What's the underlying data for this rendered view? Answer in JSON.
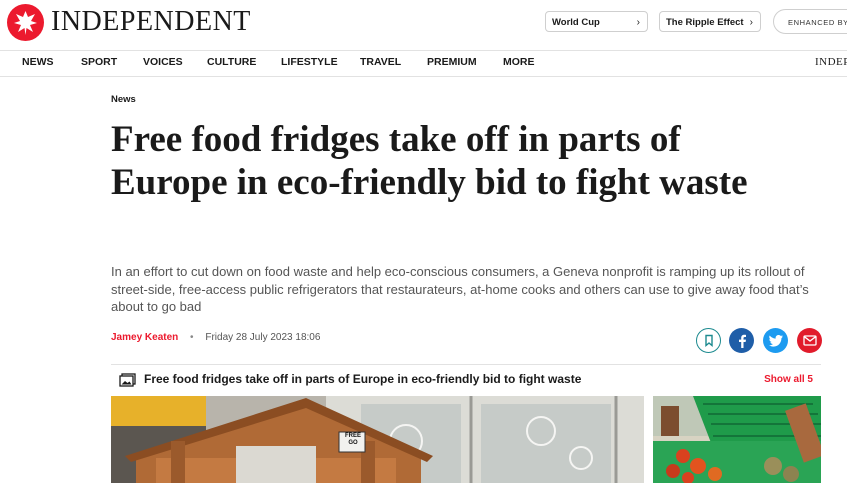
{
  "brand": {
    "wordmark": "INDEPENDENT",
    "nav_wordmark": "INDEP"
  },
  "header": {
    "pills": [
      {
        "label": "World Cup",
        "chevron": "›"
      },
      {
        "label": "The Ripple Effect",
        "chevron": "›"
      }
    ],
    "enhanced_label": "ENHANCED BY"
  },
  "nav": {
    "items": [
      "NEWS",
      "SPORT",
      "VOICES",
      "CULTURE",
      "LIFESTYLE",
      "TRAVEL",
      "PREMIUM",
      "MORE"
    ]
  },
  "article": {
    "section": "News",
    "headline": "Free food fridges take off in parts of Europe in eco-friendly bid to fight waste",
    "standfirst": "In an effort to cut down on food waste and help eco-conscious consumers, a Geneva nonprofit is ramping up its rollout of street-side, free-access public refrigerators that restaurateurs, at-home cooks and others can use to give away food that’s about to go bad",
    "author": "Jamey Keaten",
    "separator": "•",
    "date": "Friday 28 July 2023 18:06"
  },
  "share": {
    "icons": [
      "bookmark-icon",
      "facebook-icon",
      "twitter-icon",
      "email-icon"
    ],
    "colors": {
      "bookmark": "#1c8a8f",
      "facebook": "#1f5ea8",
      "twitter": "#1d9bf0",
      "email": "#e11b2b"
    }
  },
  "gallery": {
    "title": "Free food fridges take off in parts of Europe in eco-friendly bid to fight waste",
    "show_all": "Show all 5",
    "fridge_sign": "FREE GO"
  },
  "colors": {
    "accent": "#ec1a2e",
    "text": "#1a1a1a",
    "muted": "#555555"
  }
}
